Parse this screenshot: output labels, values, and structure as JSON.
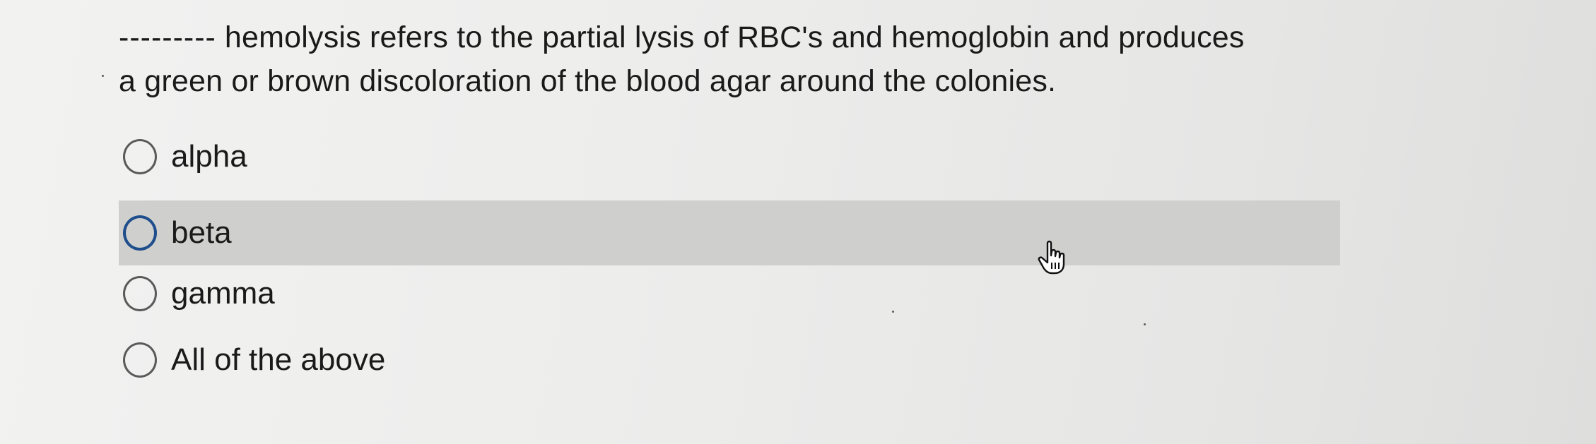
{
  "question": {
    "blank": "---------",
    "line1": "hemolysis refers to the partial lysis of RBC's and hemoglobin and produces",
    "line2": "a green or brown discoloration of the blood agar around the colonies."
  },
  "options": [
    {
      "label": "alpha",
      "selected": false,
      "hovered": false
    },
    {
      "label": "beta",
      "selected": false,
      "hovered": true
    },
    {
      "label": "gamma",
      "selected": false,
      "hovered": false
    },
    {
      "label": "All of the above",
      "selected": false,
      "hovered": false
    }
  ],
  "colors": {
    "hover_row": "#cfcfce",
    "hover_radio": "#1f4e8c",
    "radio_border": "#5a5a5a"
  },
  "icons": {
    "cursor": "hand-pointer-icon"
  }
}
